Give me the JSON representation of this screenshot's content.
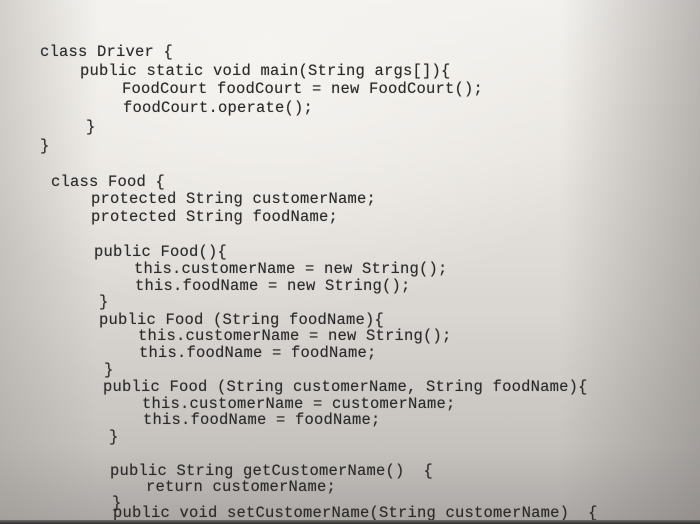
{
  "document": {
    "type": "photo of Java source code on screen",
    "lines": [
      "class Driver {",
      "public static void main(String args[]){",
      "FoodCourt foodCourt = new FoodCourt();",
      "foodCourt.operate();",
      "}",
      "}",
      "class Food {",
      "protected String customerName;",
      "protected String foodName;",
      "public Food(){",
      "this.customerName = new String();",
      "this.foodName = new String();",
      "}",
      "public Food (String foodName){",
      "this.customerName = new String();",
      "this.foodName = foodName;",
      "}",
      "public Food (String customerName, String foodName){",
      "this.customerName = customerName;",
      "this.foodName = foodName;",
      "}",
      "public String getCustomerName()  {",
      "return customerName;",
      "}",
      "public void setCustomerName(String customerName)  {"
    ]
  },
  "colors": {
    "text": "#2b2b2b",
    "background_top": "#f3f1ed",
    "background_bottom": "#aaa6a3"
  }
}
